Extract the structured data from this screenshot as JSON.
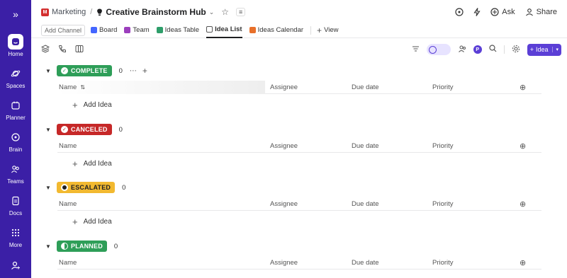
{
  "sidebar": {
    "collapse_icon": "double-chevron-right-icon",
    "items": [
      {
        "label": "Home",
        "icon": "home-icon",
        "active": true
      },
      {
        "label": "Spaces",
        "icon": "planet-icon"
      },
      {
        "label": "Planner",
        "icon": "calendar-icon"
      },
      {
        "label": "Brain",
        "icon": "brain-icon"
      },
      {
        "label": "Teams",
        "icon": "people-icon"
      },
      {
        "label": "Docs",
        "icon": "doc-icon"
      },
      {
        "label": "More",
        "icon": "grid-icon"
      }
    ],
    "invite_icon": "add-person-icon"
  },
  "header": {
    "workspace_initial": "M",
    "workspace": "Marketing",
    "separator": "/",
    "title": "Creative Brainstorm Hub",
    "actions": [
      {
        "label": "",
        "icon": "ai-icon"
      },
      {
        "label": "",
        "icon": "lightning-icon"
      },
      {
        "label": "Ask",
        "icon": "ask-icon"
      },
      {
        "label": "Share",
        "icon": "share-icon"
      }
    ]
  },
  "tabs": {
    "add_channel": "Add Channel",
    "items": [
      {
        "label": "Board",
        "color": "#4466ff"
      },
      {
        "label": "Team",
        "color": "#9b3fbd"
      },
      {
        "label": "Ideas Table",
        "color": "#2e9e6a"
      },
      {
        "label": "Idea List",
        "color": "#555555",
        "active": true
      },
      {
        "label": "Ideas Calendar",
        "color": "#e8702a"
      }
    ],
    "view_label": "View",
    "view_icon": "plus-icon"
  },
  "toolbar": {
    "assignee_badge": "P",
    "idea_button": "Idea"
  },
  "columns": {
    "name": "Name",
    "assignee": "Assignee",
    "due_date": "Due date",
    "priority": "Priority"
  },
  "add_idea": "Add Idea",
  "groups": [
    {
      "status": "COMPLETE",
      "count": "0",
      "color": "#2e9e58",
      "icon": "check-circle-icon"
    },
    {
      "status": "CANCELED",
      "count": "0",
      "color": "#c62828",
      "icon": "check-circle-icon"
    },
    {
      "status": "ESCALATED",
      "count": "0",
      "color": "#f2b930",
      "icon": "half-circle-icon"
    },
    {
      "status": "PLANNED",
      "count": "0",
      "color": "#2e9e58",
      "icon": "half-circle-icon"
    }
  ]
}
